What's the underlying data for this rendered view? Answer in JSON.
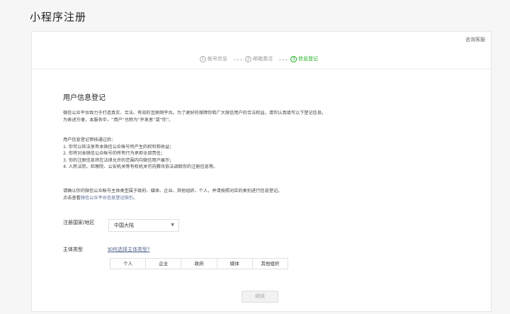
{
  "page_title": "小程序注册",
  "help_link": "咨询客服",
  "steps": [
    {
      "num": "1",
      "label": "帐号信息"
    },
    {
      "num": "2",
      "label": "邮箱激活"
    },
    {
      "num": "3",
      "label": "信息登记"
    }
  ],
  "active_step": 3,
  "accent_color": "#1aad19",
  "section_title": "用户信息登记",
  "intro": [
    "微信公众平台致力于打造真实、合法、有效的互联网平台。为了更好的保障你和广大微信用户的合法权益，请你认真填写以下登记信息。",
    "为表述方便，本服务中，“用户”也称为“开发者”或“你”。"
  ],
  "benefits": [
    "用户信息登记审核通过后：",
    "1. 你可以依法享有本微信公众帐号所产生的权利和收益；",
    "2. 你将对本微信公众帐号的所有行为承担全部责任；",
    "3. 你的注册信息将在法律允许的范围内向微信用户展示；",
    "4. 人民法院、检察院、公安机关等有权机关可向腾讯依法调取你的注册信息等。"
  ],
  "confirm_text": "请确认你的微信公众帐号主体类型属于政府、媒体、企业、其他组织、个人，并请按照对应的类别进行信息登记。",
  "guide_prefix": "点击查看",
  "guide_link": "微信公众平台信息登记指引",
  "guide_suffix": "。",
  "country_label": "注册国家/地区",
  "country_value": "中国大陆",
  "subject_type_label": "主体类型",
  "subject_type_link": "如何选择主体类型?",
  "subject_types": [
    "个人",
    "企业",
    "政府",
    "媒体",
    "其他组织"
  ],
  "continue_label": "继续"
}
